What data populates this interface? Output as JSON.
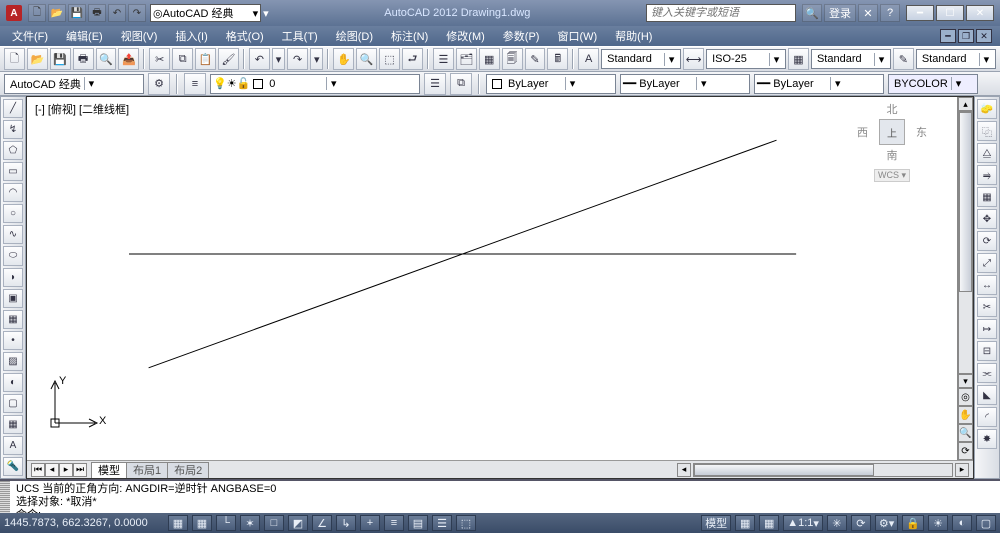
{
  "titlebar": {
    "app_icon_text": "A",
    "workspace_label": "AutoCAD 经典",
    "app_title": "AutoCAD 2012   Drawing1.dwg",
    "search_placeholder": "键入关键字或短语",
    "login_label": "登录"
  },
  "menu": {
    "items": [
      "文件(F)",
      "编辑(E)",
      "视图(V)",
      "插入(I)",
      "格式(O)",
      "工具(T)",
      "绘图(D)",
      "标注(N)",
      "修改(M)",
      "参数(P)",
      "窗口(W)",
      "帮助(H)"
    ]
  },
  "toolbar2": {
    "style_labels": [
      "Standard",
      "ISO-25",
      "Standard",
      "Standard"
    ]
  },
  "workspace_row": {
    "ws_name": "AutoCAD 经典",
    "layer_value": "0",
    "prop_labels": [
      "ByLayer",
      "ByLayer",
      "ByLayer",
      "BYCOLOR"
    ]
  },
  "canvas": {
    "viewport_label": "[-] [俯视] [二维线框]",
    "nav": {
      "north": "北",
      "west": "西",
      "top": "上",
      "east": "东",
      "south": "南",
      "wcs": "WCS ▾"
    },
    "ucs_y": "Y",
    "ucs_x": "X"
  },
  "tabs": {
    "items": [
      "模型",
      "布局1",
      "布局2"
    ]
  },
  "command": {
    "line1": "UCS 当前的正角方向:  ANGDIR=逆时针  ANGBASE=0",
    "line2": "选择对象: *取消*",
    "prompt": "命令:"
  },
  "status": {
    "coords": "1445.7873, 662.3267, 0.0000",
    "right": {
      "model": "模型",
      "scale": "1:1",
      "angle": "☀"
    }
  }
}
